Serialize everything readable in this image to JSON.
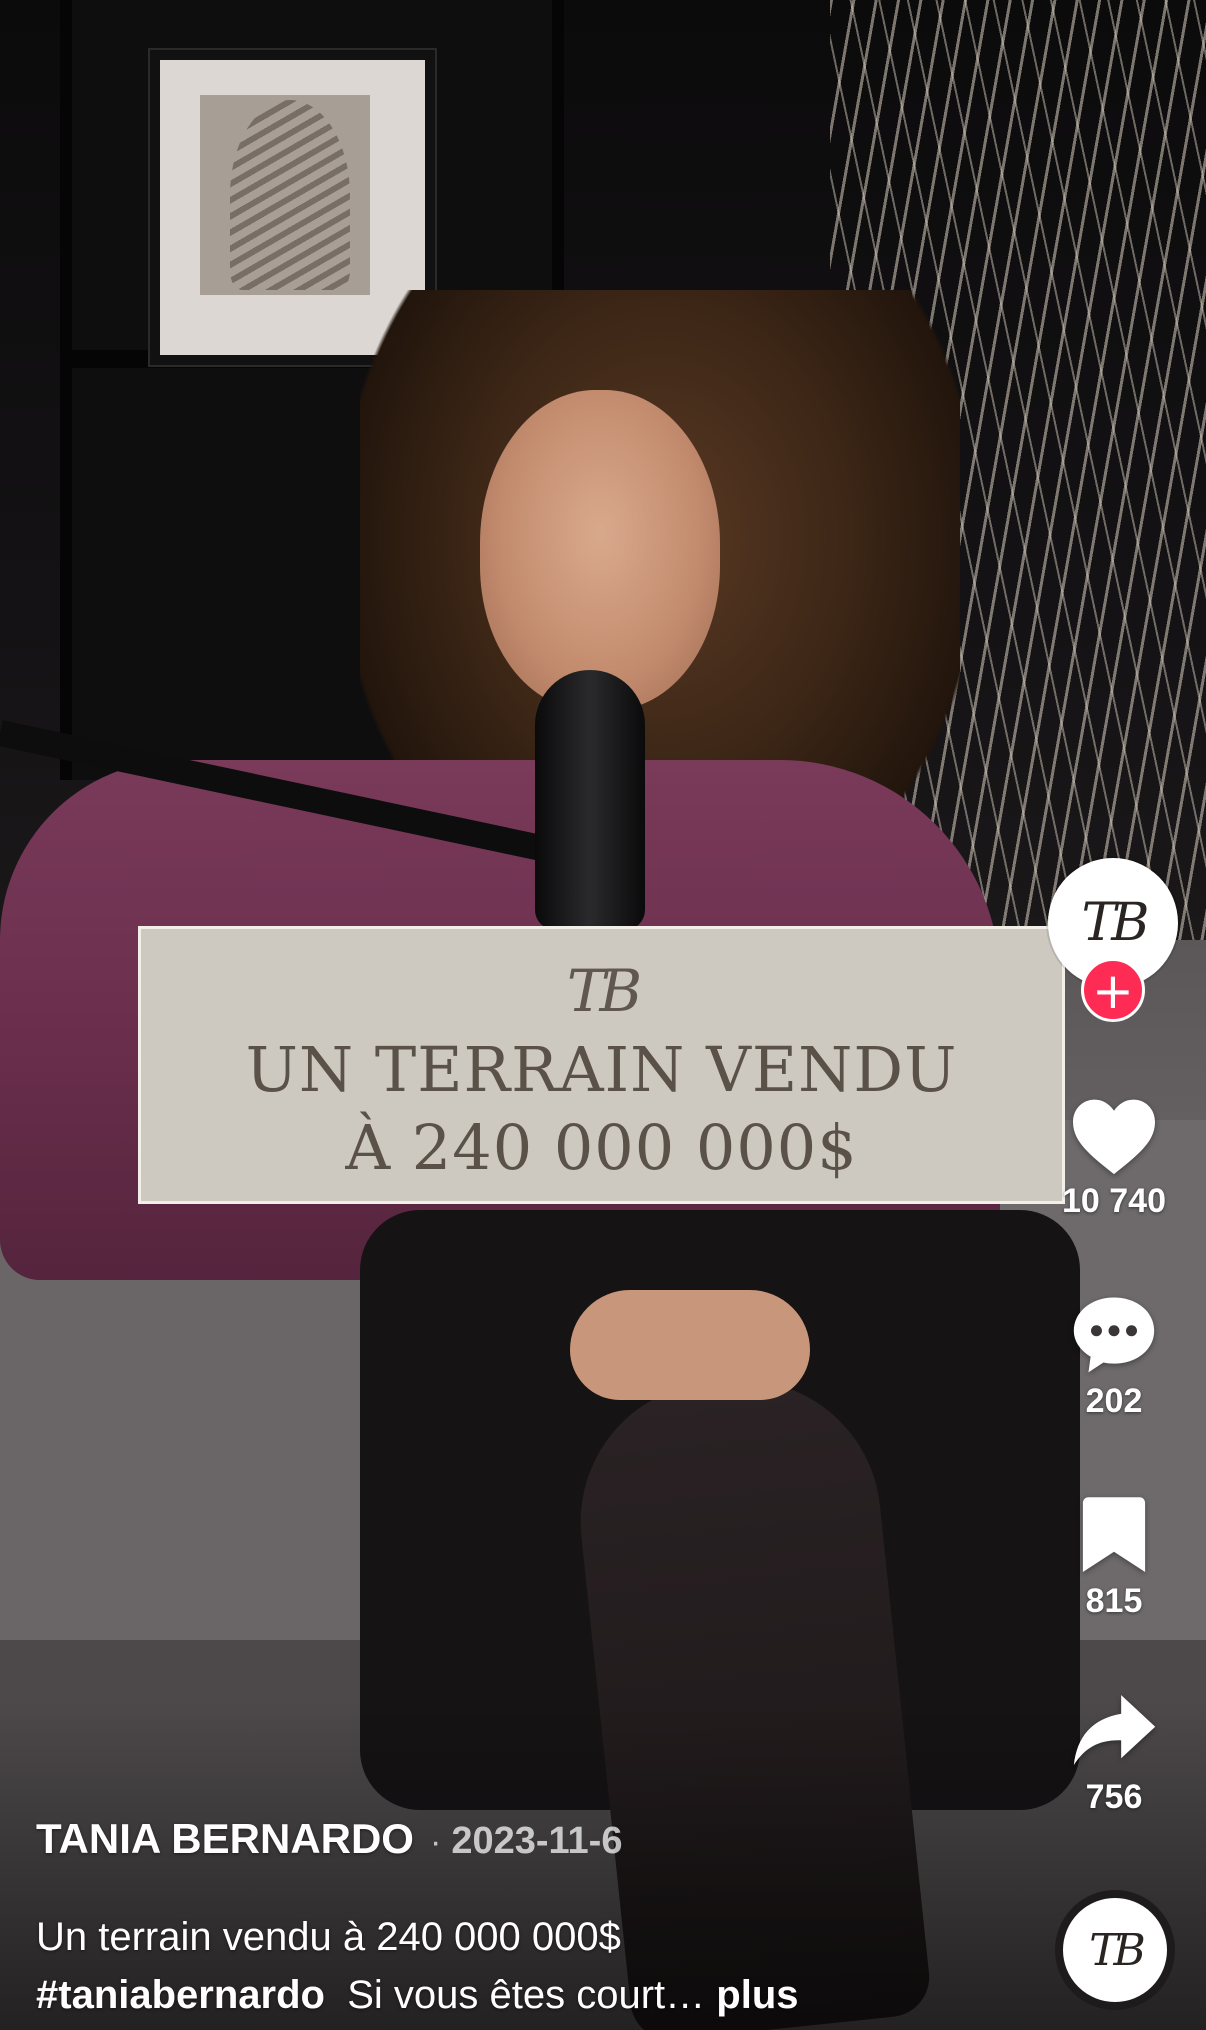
{
  "overlay": {
    "logo": "TB",
    "line1": "UN TERRAIN VENDU",
    "line2": "À 240 000 000$"
  },
  "creator": {
    "avatar_initials": "TB",
    "follow_symbol": "+",
    "name": "TANIA BERNARDO",
    "separator": "·",
    "date": "2023-11-6"
  },
  "actions": {
    "likes": "10 740",
    "comments": "202",
    "saves": "815",
    "shares": "756"
  },
  "caption": {
    "text": "Un terrain vendu à 240 000 000$",
    "hashtag": "#taniabernardo",
    "preview": "Si vous êtes court…",
    "more_label": "plus"
  },
  "sound_disc_initials": "TB",
  "icons": [
    "heart-icon",
    "comment-icon",
    "bookmark-icon",
    "share-icon",
    "plus-icon"
  ],
  "colors": {
    "follow_button": "#fe2c55",
    "overlay_bg": "#cdc8c0",
    "overlay_text": "#5a5149"
  }
}
